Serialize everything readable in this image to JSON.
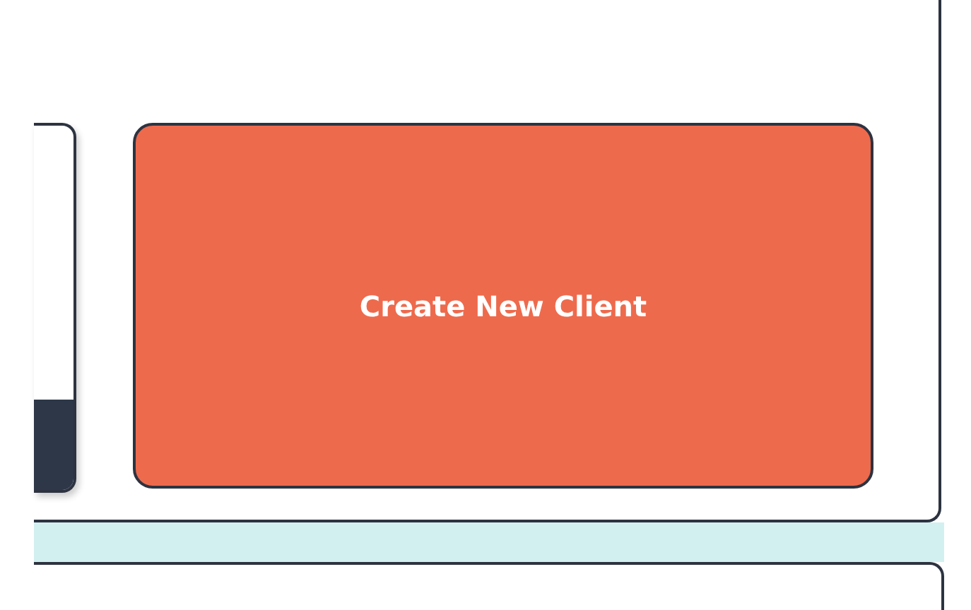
{
  "create_button": {
    "label": "Create New Client"
  }
}
